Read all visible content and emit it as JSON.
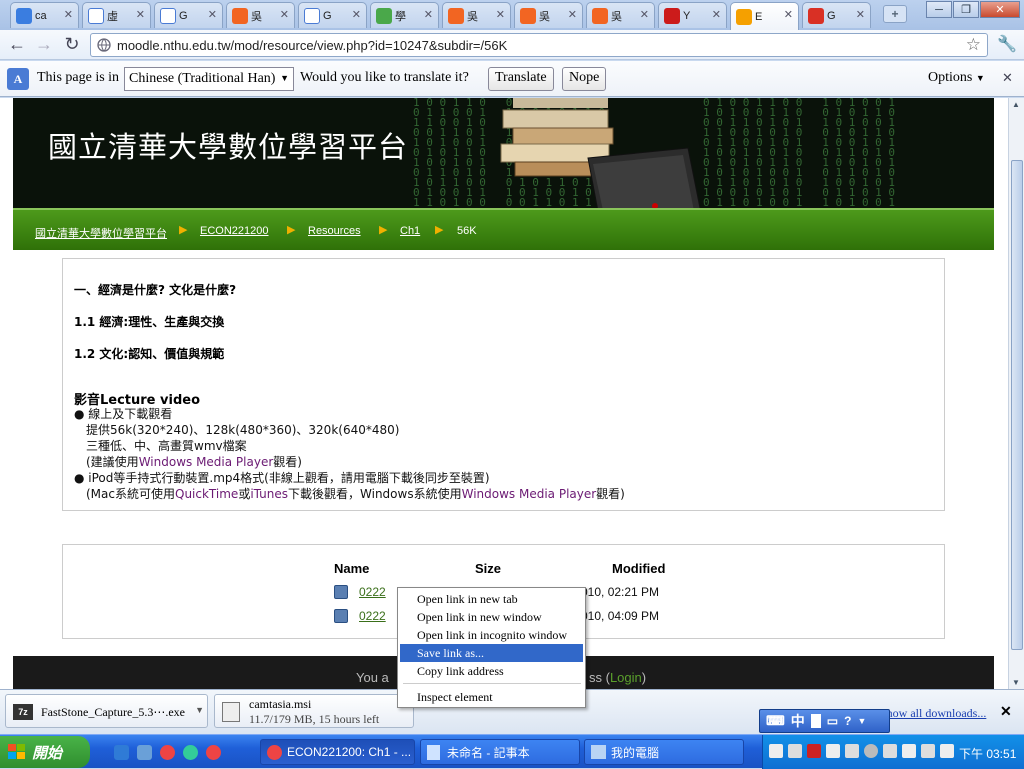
{
  "tabs": [
    {
      "title": "ca",
      "favicon": "G",
      "color": "#3a7de0"
    },
    {
      "title": "虛",
      "favicon": "doc",
      "color": "#ffffff"
    },
    {
      "title": "G",
      "favicon": "doc",
      "color": "#ffffff"
    },
    {
      "title": "吳",
      "favicon": "B",
      "color": "#f26522"
    },
    {
      "title": "G",
      "favicon": "doc",
      "color": "#ffffff"
    },
    {
      "title": "學",
      "favicon": "S",
      "color": "#4aa84a"
    },
    {
      "title": "吳",
      "favicon": "B",
      "color": "#f26522"
    },
    {
      "title": "吳",
      "favicon": "B",
      "color": "#f26522"
    },
    {
      "title": "吳",
      "favicon": "B",
      "color": "#f26522"
    },
    {
      "title": "Y",
      "favicon": "You",
      "color": "#cc1b1b"
    },
    {
      "title": "E",
      "favicon": "m",
      "color": "#f5a000",
      "active": true
    },
    {
      "title": "G",
      "favicon": "M",
      "color": "#d93025"
    }
  ],
  "address_bar": {
    "url": "moodle.nthu.edu.tw/mod/resource/view.php?id=10247&subdir=/56K"
  },
  "infobar": {
    "prefix": "This page is in",
    "language": "Chinese (Traditional Han)",
    "question": "Would you like to translate it?",
    "translate_label": "Translate",
    "nope_label": "Nope",
    "options_label": "Options"
  },
  "site": {
    "name": "國立清華大學數位學習平台"
  },
  "breadcrumb": [
    "國立清華大學數位學習平台",
    "ECON221200",
    "Resources",
    "Ch1",
    "56K"
  ],
  "course_text": {
    "heading1": "一、經濟是什麼? 文化是什麼?",
    "heading2": "1.1 經濟:理性、生產與交換",
    "heading3": "1.2 文化:認知、價值與規範",
    "video_title": "影音Lecture video",
    "b1": "● 線上及下載觀看",
    "b1_l1": "提供56k(320*240)、128k(480*360)、320k(640*480)",
    "b1_l2": "三種低、中、高畫質wmv檔案",
    "b1_l3_pre": "(建議使用",
    "b1_l3_link": "Windows Media Player",
    "b1_l3_post": "觀看)",
    "b2": "● iPod等手持式行動裝置.mp4格式(非線上觀看，請用電腦下載後同步至裝置)",
    "b2_l1_pre": "(Mac系統可使用",
    "b2_l1_qt": "QuickTime",
    "b2_l1_or": "或",
    "b2_l1_it": "iTunes",
    "b2_l1_mid": "下載後觀看，Windows系統使用",
    "b2_l1_wmp": "Windows Media Player",
    "b2_l1_post": "觀看)"
  },
  "file_table": {
    "headers": [
      "Name",
      "Size",
      "Modified"
    ],
    "rows": [
      {
        "name": "0222",
        "modified": "010, 02:21 PM"
      },
      {
        "name": "0222",
        "modified": "010, 04:09 PM"
      }
    ]
  },
  "footer": {
    "pre": "You a",
    "post": "ss (",
    "login": "Login",
    "close": ")"
  },
  "context_menu": {
    "items": [
      "Open link in new tab",
      "Open link in new window",
      "Open link in incognito window",
      "Save link as...",
      "Copy link address",
      "Inspect element"
    ]
  },
  "downloads": [
    {
      "name": "FastStone_Capture_5.3⋯.exe",
      "status": ""
    },
    {
      "name": "camtasia.msi",
      "status": "11.7/179 MB, 15 hours left"
    }
  ],
  "downloads_link": "Show all downloads...",
  "taskbar": {
    "start_label": "開始",
    "tasks": [
      "ECON221200: Ch1 - ...",
      "未命名 - 記事本",
      "我的電腦"
    ],
    "clock": "下午 03:51",
    "ime": "中"
  }
}
